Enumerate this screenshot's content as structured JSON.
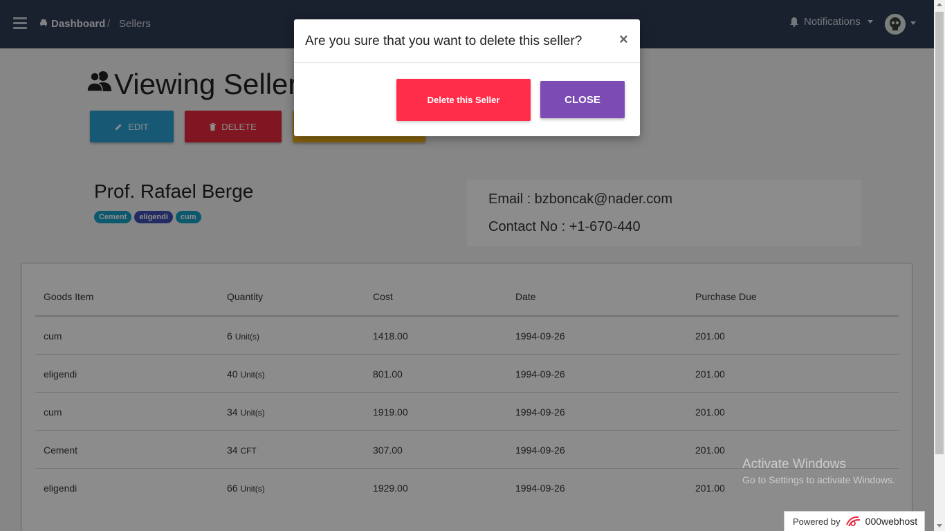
{
  "navbar": {
    "breadcrumb_home": "Dashboard",
    "breadcrumb_separator": "/",
    "breadcrumb_current": "Sellers",
    "notifications_label": "Notifications"
  },
  "page": {
    "title": "Viewing Seller",
    "edit_label": "EDIT",
    "delete_label": "DELETE"
  },
  "seller": {
    "name": "Prof. Rafael Berge",
    "tags": [
      "Cement",
      "eligendi",
      "cum"
    ],
    "email_line": "Email : bzboncak@nader.com",
    "contact_line": "Contact No : +1-670-440"
  },
  "table": {
    "headers": [
      "Goods Item",
      "Quantity",
      "Cost",
      "Date",
      "Purchase Due"
    ],
    "rows": [
      {
        "item": "cum",
        "qty": "6",
        "unit": "Unit(s)",
        "cost": "1418.00",
        "date": "1994-09-26",
        "due": "201.00"
      },
      {
        "item": "eligendi",
        "qty": "40",
        "unit": "Unit(s)",
        "cost": "801.00",
        "date": "1994-09-26",
        "due": "201.00"
      },
      {
        "item": "cum",
        "qty": "34",
        "unit": "Unit(s)",
        "cost": "1919.00",
        "date": "1994-09-26",
        "due": "201.00"
      },
      {
        "item": "Cement",
        "qty": "34",
        "unit": "CFT",
        "cost": "307.00",
        "date": "1994-09-26",
        "due": "201.00"
      },
      {
        "item": "eligendi",
        "qty": "66",
        "unit": "Unit(s)",
        "cost": "1929.00",
        "date": "1994-09-26",
        "due": "201.00"
      }
    ]
  },
  "modal": {
    "title": "Are you sure that you want to delete this seller?",
    "close_symbol": "×",
    "delete_label": "Delete this Seller",
    "close_label": "CLOSE"
  },
  "watermark": {
    "line1": "Activate Windows",
    "line2": "Go to Settings to activate Windows."
  },
  "footer": {
    "powered_by": "Powered by",
    "brand": "000webhost"
  },
  "colors": {
    "navbar": "#303c54",
    "edit": "#2ba3d6",
    "delete": "#e8283e",
    "warning": "#f5b41b",
    "modal_delete": "#ff2d4a",
    "modal_close": "#7c4cb4",
    "tag_cement": "#17a2c8",
    "tag_eligendi": "#3f51b5",
    "tag_cum": "#17a2c8"
  },
  "icons": [
    "menu-icon",
    "car-icon",
    "bell-icon",
    "skull-avatar",
    "users-icon",
    "pencil-icon",
    "trash-icon",
    "close-icon",
    "webhost-logo-icon"
  ]
}
